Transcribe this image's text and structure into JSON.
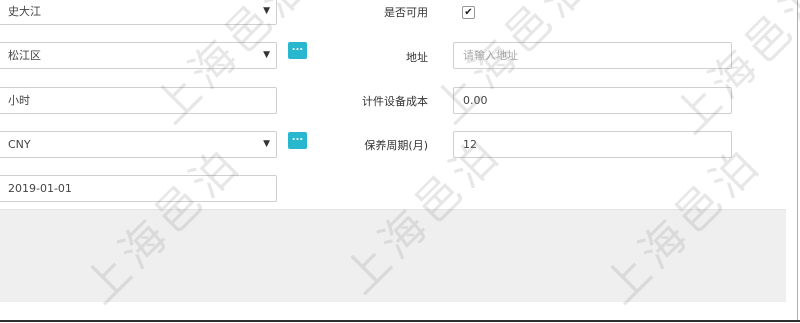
{
  "form": {
    "row1": {
      "select_value": "史大江",
      "label": "是否可用",
      "checkbox_checked": "✔"
    },
    "row2": {
      "select_value": "松江区",
      "more_btn": "...",
      "label": "地址",
      "placeholder": "请输入地址"
    },
    "row3": {
      "input_value": "小时",
      "label": "计件设备成本",
      "input_value_right": "0.00"
    },
    "row4": {
      "select_value": "CNY",
      "more_btn": "...",
      "label": "保养周期(月)",
      "input_value_right": "12"
    },
    "row5": {
      "input_value": "2019-01-01"
    }
  },
  "icons": {
    "caret": "chevron-down-icon",
    "check": "check-icon"
  },
  "watermark": {
    "text": "上海邑泊"
  },
  "colors": {
    "accent_button": "#29b6cf",
    "footer_band": "#efefef"
  }
}
